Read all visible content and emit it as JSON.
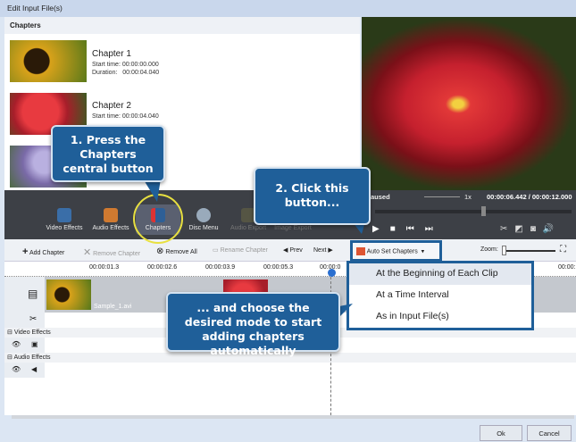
{
  "window": {
    "title": "Edit Input File(s)"
  },
  "chapters_panel": {
    "header": "Chapters",
    "items": [
      {
        "title": "Chapter 1",
        "start_label": "Start time:",
        "start": "00:00:00.000",
        "duration_label": "Duration:",
        "duration": "00:00:04.040"
      },
      {
        "title": "Chapter 2",
        "start_label": "Start time:",
        "start": "00:00:04.040"
      }
    ]
  },
  "player": {
    "status": "Paused",
    "speed": "1x",
    "time": "00:00:06.442 / 00:00:12.000",
    "seek_progress": 0.54
  },
  "main_toolbar": [
    "Video Effects",
    "Audio Effects",
    "Chapters",
    "Disc Menu",
    "Audio Export",
    "Image Export"
  ],
  "chapter_toolbar": {
    "add": "Add Chapter",
    "remove": "Remove Chapter",
    "remove_all": "Remove All",
    "rename": "Rename Chapter",
    "prev": "Prev",
    "next": "Next",
    "auto_set": "Auto Set Chapters",
    "zoom": "Zoom:"
  },
  "ruler": [
    "00:00:01.3",
    "00:00:02.6",
    "00:00:03.9",
    "00:00:05.3",
    "00:00:0",
    "00:00:"
  ],
  "timeline": {
    "clip_name": "Sample_1.avi",
    "video_effects": "Video Effects",
    "audio_effects": "Audio Effects"
  },
  "dropdown": [
    "At the Beginning of Each Clip",
    "At a Time Interval",
    "As in Input File(s)"
  ],
  "callouts": {
    "step1": "1. Press the Chapters central button",
    "step2": "2. Click this button...",
    "step3": "... and choose the desired mode to start adding chapters automatically"
  },
  "buttons": {
    "ok": "Ok",
    "cancel": "Cancel"
  },
  "colors": {
    "callout": "#1f5f99",
    "highlight_circle": "#e8e040"
  }
}
